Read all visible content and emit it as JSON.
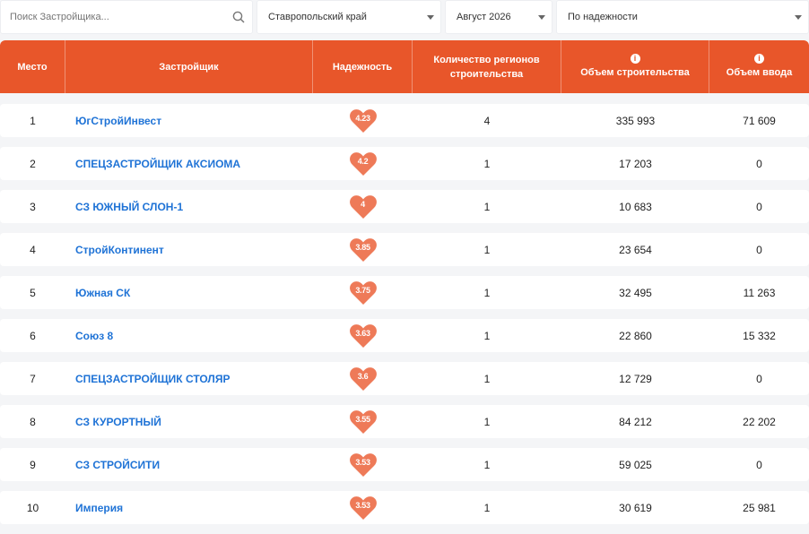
{
  "filters": {
    "search_placeholder": "Поиск Застройщика...",
    "region": "Ставропольский край",
    "period": "Август 2026",
    "sort": "По надежности"
  },
  "table": {
    "columns": [
      "Место",
      "Застройщик",
      "Надежность",
      "Количество регионов строительства",
      "Объем строительства",
      "Объем ввода"
    ],
    "info_icon_glyph": "i",
    "rows": [
      {
        "place": "1",
        "developer": "ЮгСтройИнвест",
        "rating": "4.23",
        "regions": "4",
        "volume": "335 993",
        "input": "71 609"
      },
      {
        "place": "2",
        "developer": "СПЕЦЗАСТРОЙЩИК АКСИОМА",
        "rating": "4.2",
        "regions": "1",
        "volume": "17 203",
        "input": "0"
      },
      {
        "place": "3",
        "developer": "СЗ ЮЖНЫЙ СЛОН-1",
        "rating": "4",
        "regions": "1",
        "volume": "10 683",
        "input": "0"
      },
      {
        "place": "4",
        "developer": "СтройКонтинент",
        "rating": "3.85",
        "regions": "1",
        "volume": "23 654",
        "input": "0"
      },
      {
        "place": "5",
        "developer": "Южная СК",
        "rating": "3.75",
        "regions": "1",
        "volume": "32 495",
        "input": "11 263"
      },
      {
        "place": "6",
        "developer": "Союз 8",
        "rating": "3.63",
        "regions": "1",
        "volume": "22 860",
        "input": "15 332"
      },
      {
        "place": "7",
        "developer": "СПЕЦЗАСТРОЙЩИК СТОЛЯР",
        "rating": "3.6",
        "regions": "1",
        "volume": "12 729",
        "input": "0"
      },
      {
        "place": "8",
        "developer": "СЗ КУРОРТНЫЙ",
        "rating": "3.55",
        "regions": "1",
        "volume": "84 212",
        "input": "22 202"
      },
      {
        "place": "9",
        "developer": "СЗ СТРОЙСИТИ",
        "rating": "3.53",
        "regions": "1",
        "volume": "59 025",
        "input": "0"
      },
      {
        "place": "10",
        "developer": "Империя",
        "rating": "3.53",
        "regions": "1",
        "volume": "30 619",
        "input": "25 981"
      }
    ]
  },
  "colors": {
    "accent": "#e8562a",
    "heart": "#ee7a58",
    "link": "#1f73d6"
  },
  "icons": {
    "search": "search-icon",
    "dropdown": "chevron-down-icon",
    "info": "info-icon",
    "rating": "heart-icon"
  }
}
